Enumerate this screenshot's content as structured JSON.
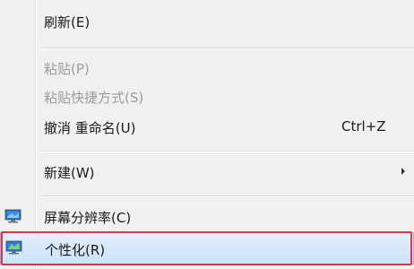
{
  "menu": {
    "items": [
      {
        "label": "刷新(E)"
      },
      {
        "label": "粘贴(P)"
      },
      {
        "label": "粘贴快捷方式(S)"
      },
      {
        "label": "撤消 重命名(U)",
        "shortcut": "Ctrl+Z"
      },
      {
        "label": "新建(W)"
      },
      {
        "label": "屏幕分辨率(C)",
        "icon": "monitor-icon"
      },
      {
        "label": "个性化(R)",
        "icon": "personalize-monitor-icon"
      }
    ]
  },
  "colors": {
    "highlight_border": "#d23a45",
    "hover_fill": "#cde2f8"
  }
}
